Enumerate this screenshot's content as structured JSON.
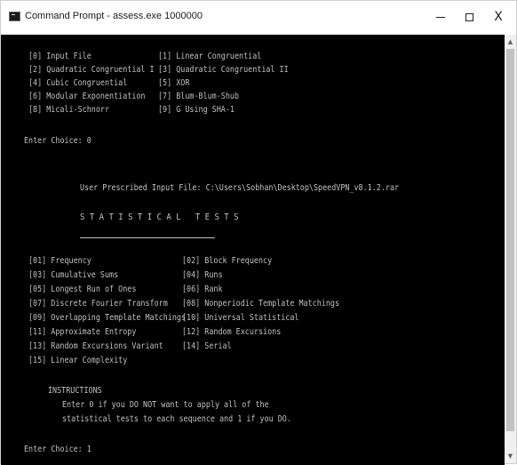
{
  "window": {
    "title": "Command Prompt - assess.exe 1000000",
    "minimize_icon": "minimize-icon",
    "maximize_icon": "maximize-icon",
    "close_glyph": "X"
  },
  "menu": {
    "items": [
      {
        "left": "[0] Input File",
        "right": "[1] Linear Congruential"
      },
      {
        "left": "[2] Quadratic Congruential I",
        "right": "[3] Quadratic Congruential II"
      },
      {
        "left": "[4] Cubic Congruential",
        "right": "[5] XOR"
      },
      {
        "left": "[6] Modular Exponentiation",
        "right": "[7] Blum-Blum-Shub"
      },
      {
        "left": "[8] Micali-Schnorr",
        "right": "[9] G Using SHA-1"
      }
    ],
    "prompt": "Enter Choice: 0"
  },
  "input_file_line": "User Prescribed Input File: C:\\Users\\Sobhan\\Desktop\\SpeedVPN_v8.1.2.rar",
  "tests_heading": "STATISTICAL TESTS",
  "tests": [
    {
      "left": "[01] Frequency",
      "right": "[02] Block Frequency"
    },
    {
      "left": "[03] Cumulative Sums",
      "right": "[04] Runs"
    },
    {
      "left": "[05] Longest Run of Ones",
      "right": "[06] Rank"
    },
    {
      "left": "[07] Discrete Fourier Transform",
      "right": "[08] Nonperiodic Template Matchings"
    },
    {
      "left": "[09] Overlapping Template Matchings",
      "right": "[10] Universal Statistical"
    },
    {
      "left": "[11] Approximate Entropy",
      "right": "[12] Random Excursions"
    },
    {
      "left": "[13] Random Excursions Variant",
      "right": "[14] Serial"
    },
    {
      "left": "[15] Linear Complexity",
      "right": ""
    }
  ],
  "instructions": {
    "heading": "INSTRUCTIONS",
    "line1": "Enter 0 if you DO NOT want to apply all of the",
    "line2": "statistical tests to each sequence and 1 if you DO."
  },
  "final_prompt": "Enter Choice: 1",
  "colors": {
    "console_bg": "#000000",
    "console_text": "#c0c0c0",
    "titlebar_bg": "#ffffff"
  }
}
